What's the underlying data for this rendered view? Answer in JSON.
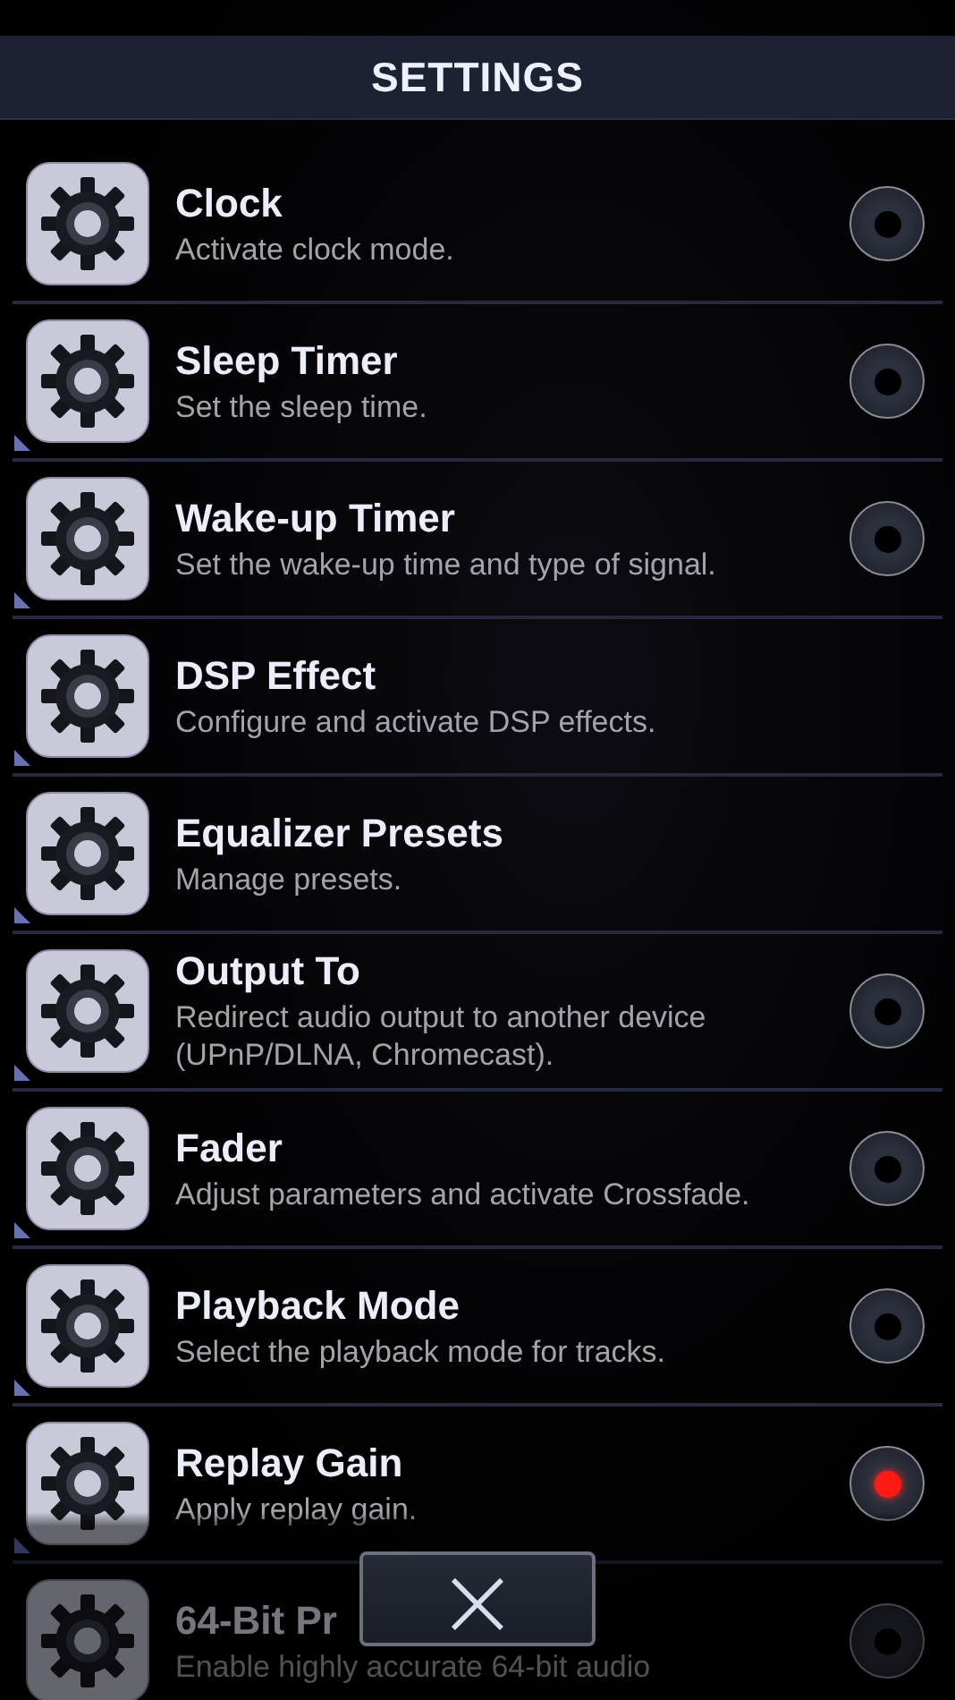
{
  "header": {
    "title": "SETTINGS"
  },
  "items": [
    {
      "title": "Clock",
      "description": "Activate clock mode.",
      "submenu": false,
      "kind": "toggle",
      "on": false
    },
    {
      "title": "Sleep Timer",
      "description": "Set the sleep time.",
      "submenu": true,
      "kind": "toggle",
      "on": false
    },
    {
      "title": "Wake-up Timer",
      "description": "Set the wake-up time and type of signal.",
      "submenu": true,
      "kind": "toggle",
      "on": false
    },
    {
      "title": "DSP Effect",
      "description": "Configure and activate DSP effects.",
      "submenu": true,
      "kind": "plain"
    },
    {
      "title": "Equalizer Presets",
      "description": "Manage presets.",
      "submenu": true,
      "kind": "plain"
    },
    {
      "title": "Output To",
      "description": "Redirect audio output to another device (UPnP/DLNA, Chromecast).",
      "submenu": true,
      "kind": "toggle",
      "on": false
    },
    {
      "title": "Fader",
      "description": "Adjust parameters and activate Crossfade.",
      "submenu": true,
      "kind": "toggle",
      "on": false
    },
    {
      "title": "Playback Mode",
      "description": "Select the playback mode for tracks.",
      "submenu": true,
      "kind": "toggle",
      "on": false
    },
    {
      "title": "Replay Gain",
      "description": "Apply replay gain.",
      "submenu": true,
      "kind": "toggle",
      "on": true
    },
    {
      "title": "64-Bit Pr",
      "description": "Enable highly accurate 64-bit audio",
      "submenu": false,
      "kind": "toggle",
      "on": false
    }
  ],
  "close_button": {
    "label": "×"
  }
}
